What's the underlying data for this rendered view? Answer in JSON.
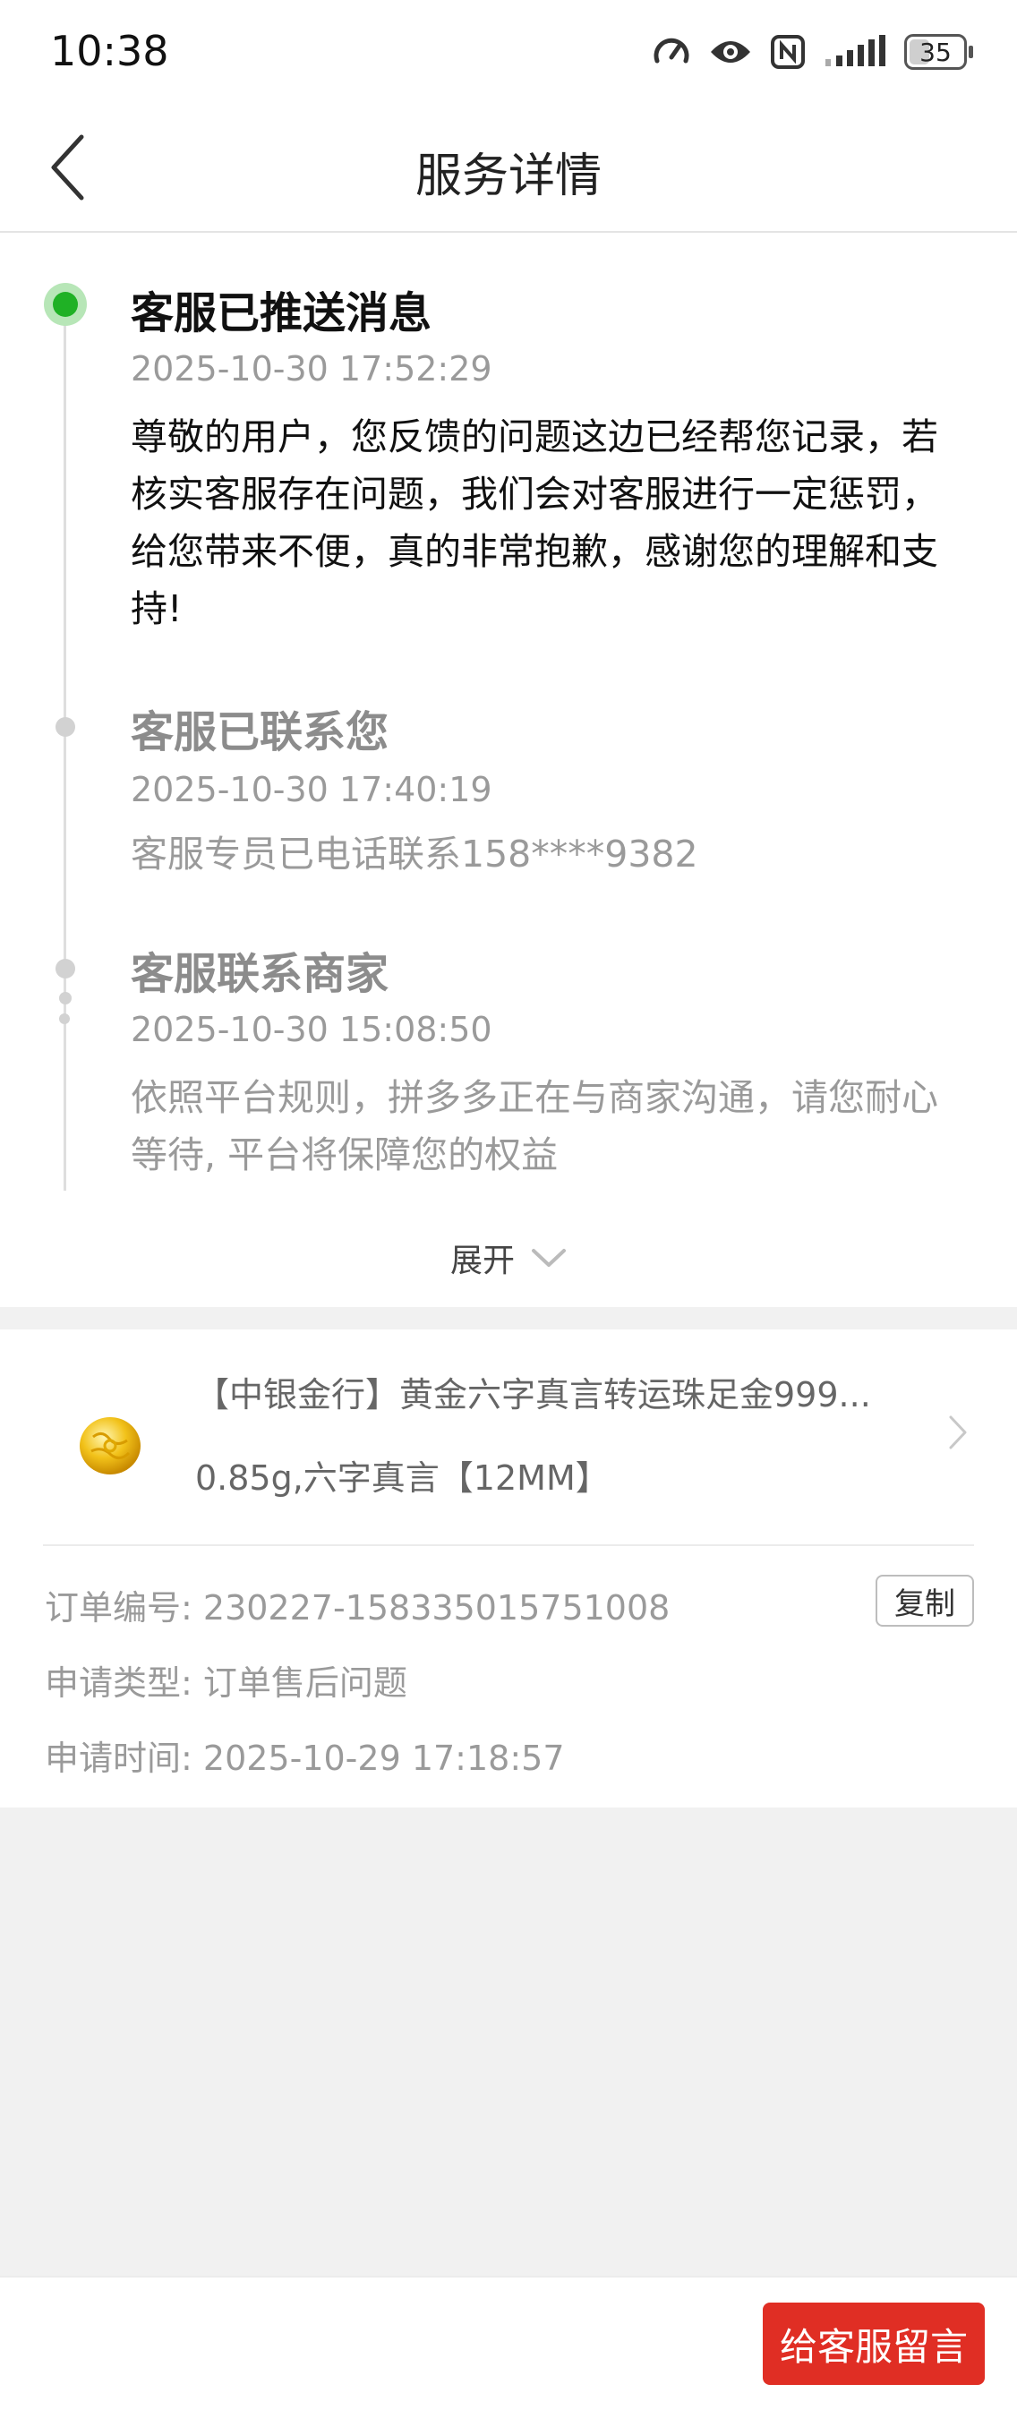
{
  "status_bar": {
    "time": "10:38",
    "battery": "35",
    "icons": [
      "speedometer-icon",
      "eye-icon",
      "nfc-icon",
      "signal-icon",
      "battery-icon"
    ]
  },
  "header": {
    "title": "服务详情"
  },
  "timeline": {
    "events": [
      {
        "title": "客服已推送消息",
        "time": "2025-10-30 17:52:29",
        "body": "尊敬的用户，您反馈的问题这边已经帮您记录，若核实客服存在问题，我们会对客服进行一定惩罚，给您带来不便，真的非常抱歉，感谢您的理解和支持!"
      },
      {
        "title": "客服已联系您",
        "time": "2025-10-30 17:40:19",
        "body": "客服专员已电话联系158****9382"
      },
      {
        "title": "客服联系商家",
        "time": "2025-10-30 15:08:50",
        "body": "依照平台规则，拼多多正在与商家沟通，请您耐心等待, 平台将保障您的权益"
      }
    ],
    "expand_label": "展开"
  },
  "order": {
    "product_name": "【中银金行】黄金六字真言转运珠足金999...",
    "product_spec": "0.85g,六字真言【12MM】",
    "order_no_label": "订单编号:",
    "order_no": "230227-158335015751008",
    "copy_label": "复制",
    "type_label": "申请类型:",
    "type_value": "订单售后问题",
    "time_label": "申请时间:",
    "time_value": "2025-10-29 17:18:57"
  },
  "bottom": {
    "leave_message_label": "给客服留言"
  },
  "colors": {
    "accent_red": "#e02e24",
    "active_green": "#1fb125",
    "page_bg": "#f1f1f1"
  }
}
